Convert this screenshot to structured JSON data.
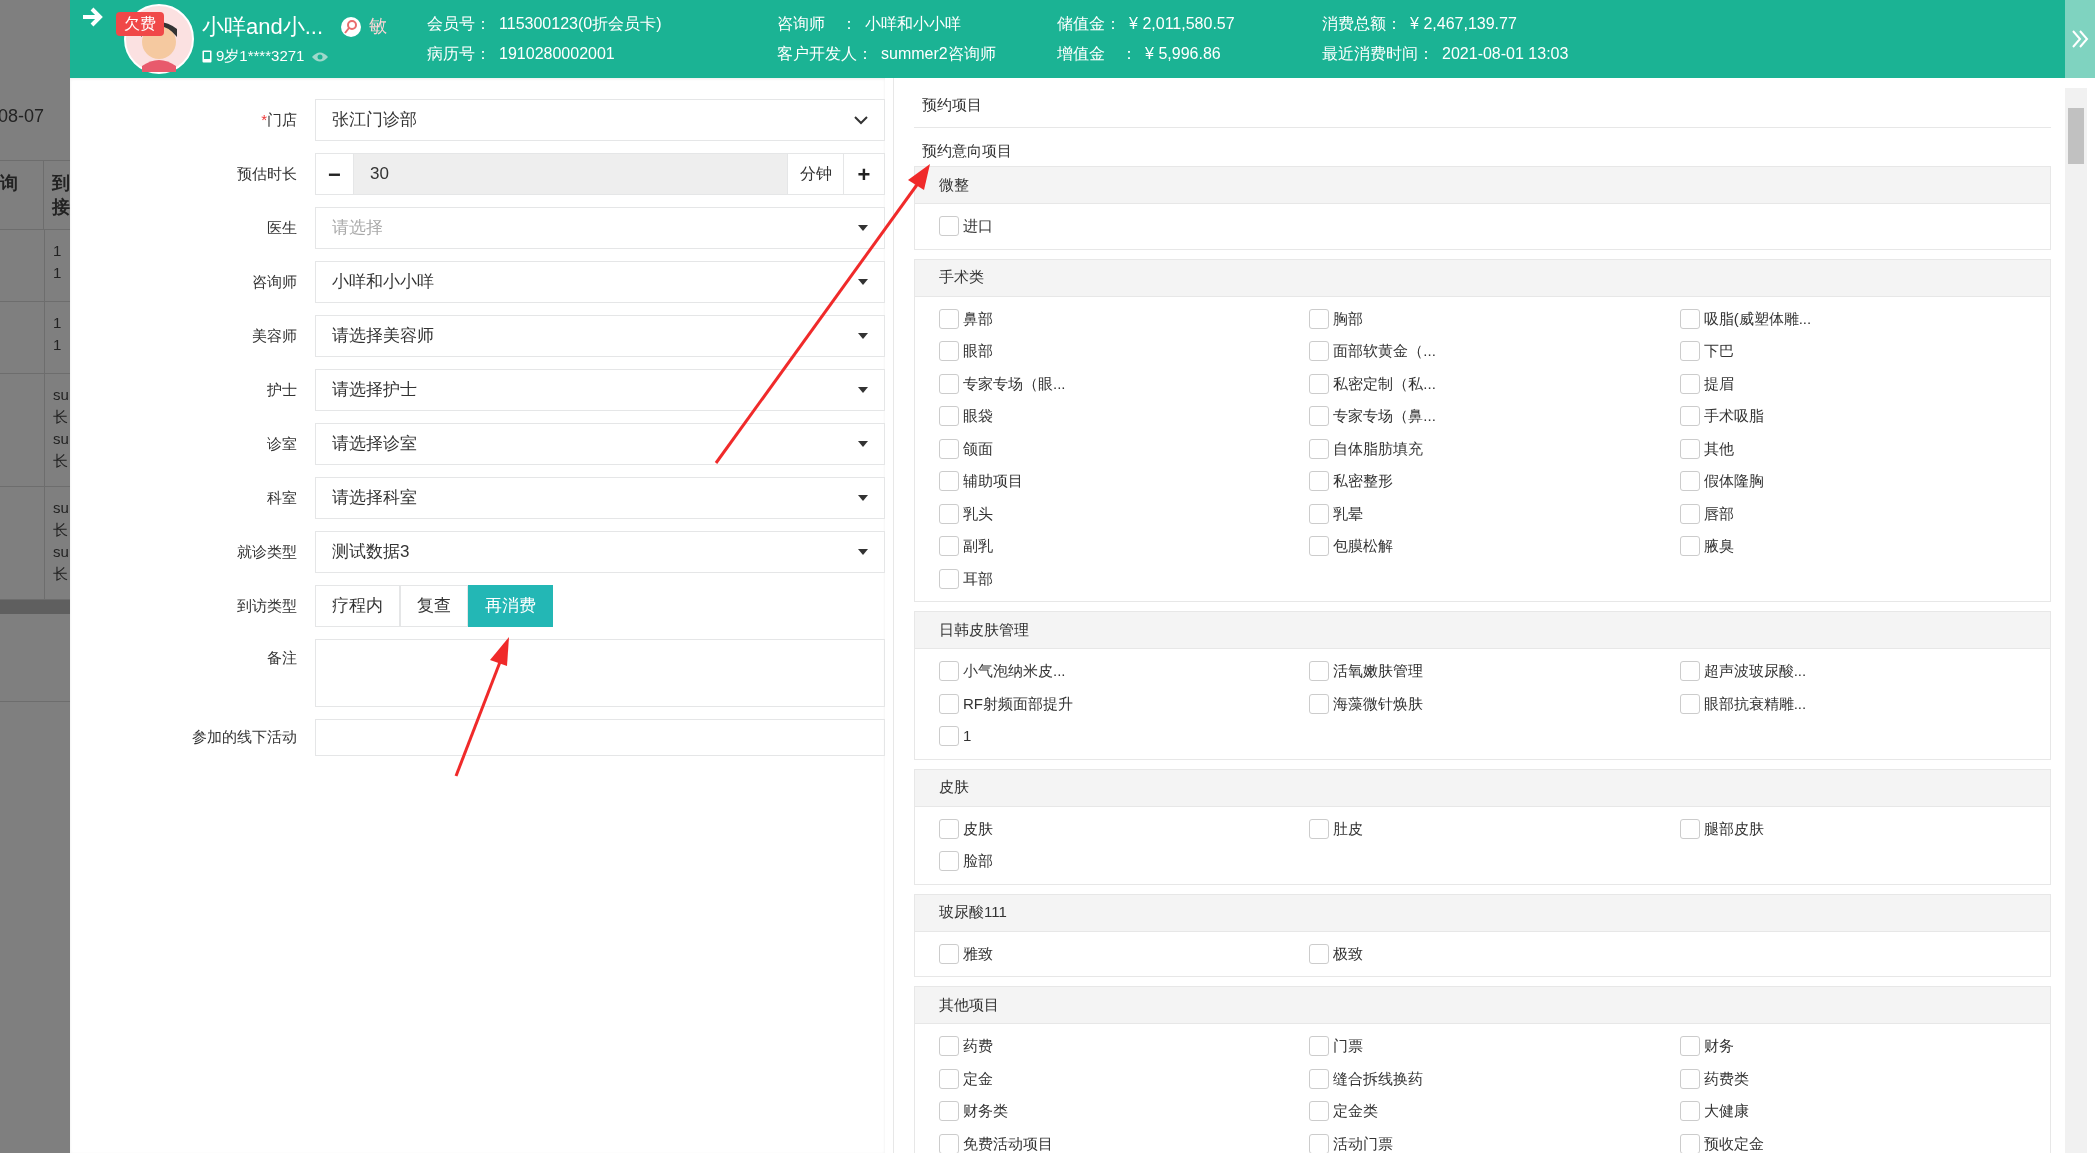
{
  "background_page": {
    "date": "08-07",
    "header_cells": [
      [
        "询"
      ],
      [
        "到",
        "接"
      ]
    ],
    "rows": [
      [
        "1",
        "1"
      ],
      [
        "1",
        "1"
      ],
      [
        "su",
        "长",
        "su",
        "长"
      ],
      [
        "su",
        "长",
        "su",
        "长"
      ]
    ]
  },
  "header": {
    "badge": "欠费",
    "name": "小咩and小...",
    "tag": "敏",
    "phone": "9岁1****3271",
    "groups": [
      [
        {
          "label": "会员号：",
          "value": "115300123(0折会员卡)"
        },
        {
          "label": "病历号：",
          "value": "1910280002001"
        }
      ],
      [
        {
          "label": "咨询师　：",
          "value": "小咩和小小咩"
        },
        {
          "label": "客户开发人：",
          "value": "summer2咨询师"
        }
      ],
      [
        {
          "label": "储值金：",
          "value": "¥ 2,011,580.57"
        },
        {
          "label": "增值金　：",
          "value": "¥ 5,996.86"
        }
      ],
      [
        {
          "label": "消费总额：",
          "value": "¥ 2,467,139.77"
        },
        {
          "label": "最近消费时间：",
          "value": "2021-08-01 13:03"
        }
      ]
    ]
  },
  "form": [
    {
      "kind": "native_select",
      "label": "门店",
      "required_mark": "*",
      "value": "张江门诊部"
    },
    {
      "kind": "stepper",
      "label": "预估时长",
      "minus": "−",
      "value": "30",
      "unit": "分钟",
      "plus": "+"
    },
    {
      "kind": "select",
      "label": "医生",
      "placeholder": "请选择"
    },
    {
      "kind": "select",
      "label": "咨询师",
      "value": "小咩和小小咩"
    },
    {
      "kind": "select",
      "label": "美容师",
      "value": "请选择美容师"
    },
    {
      "kind": "select",
      "label": "护士",
      "value": "请选择护士"
    },
    {
      "kind": "select",
      "label": "诊室",
      "value": "请选择诊室"
    },
    {
      "kind": "select",
      "label": "科室",
      "value": "请选择科室"
    },
    {
      "kind": "select",
      "label": "就诊类型",
      "value": "测试数据3"
    },
    {
      "kind": "segmented",
      "label": "到访类型",
      "options": [
        {
          "label": "疗程内",
          "selected": false
        },
        {
          "label": "复查",
          "selected": false
        },
        {
          "label": "再消费",
          "selected": true
        }
      ]
    },
    {
      "kind": "textarea",
      "label": "备注"
    },
    {
      "kind": "input",
      "label": "参加的线下活动"
    }
  ],
  "projects": {
    "title": "预约项目",
    "subtitle": "预约意向项目",
    "sections": [
      {
        "title": "微整",
        "items": [
          {
            "label": "进口",
            "checked": false
          }
        ]
      },
      {
        "title": "手术类",
        "items": [
          {
            "label": "鼻部",
            "checked": false
          },
          {
            "label": "胸部",
            "checked": false
          },
          {
            "label": "吸脂(威塑体雕...",
            "checked": false
          },
          {
            "label": "眼部",
            "checked": false
          },
          {
            "label": "面部软黄金（...",
            "checked": false
          },
          {
            "label": "下巴",
            "checked": false
          },
          {
            "label": "专家专场（眼...",
            "checked": false
          },
          {
            "label": "私密定制（私...",
            "checked": false
          },
          {
            "label": "提眉",
            "checked": false
          },
          {
            "label": "眼袋",
            "checked": false
          },
          {
            "label": "专家专场（鼻...",
            "checked": false
          },
          {
            "label": "手术吸脂",
            "checked": false
          },
          {
            "label": "颌面",
            "checked": false
          },
          {
            "label": "自体脂肪填充",
            "checked": false
          },
          {
            "label": "其他",
            "checked": false
          },
          {
            "label": "辅助项目",
            "checked": false
          },
          {
            "label": "私密整形",
            "checked": false
          },
          {
            "label": "假体隆胸",
            "checked": false
          },
          {
            "label": "乳头",
            "checked": false
          },
          {
            "label": "乳晕",
            "checked": false
          },
          {
            "label": "唇部",
            "checked": false
          },
          {
            "label": "副乳",
            "checked": false
          },
          {
            "label": "包膜松解",
            "checked": false
          },
          {
            "label": "腋臭",
            "checked": false
          },
          {
            "label": "耳部",
            "checked": false
          }
        ]
      },
      {
        "title": "日韩皮肤管理",
        "items": [
          {
            "label": "小气泡纳米皮...",
            "checked": false
          },
          {
            "label": "活氧嫩肤管理",
            "checked": false
          },
          {
            "label": "超声波玻尿酸...",
            "checked": false
          },
          {
            "label": "RF射频面部提升",
            "checked": false
          },
          {
            "label": "海藻微针焕肤",
            "checked": false
          },
          {
            "label": "眼部抗衰精雕...",
            "checked": false
          },
          {
            "label": "1",
            "checked": false
          }
        ]
      },
      {
        "title": "皮肤",
        "items": [
          {
            "label": "皮肤",
            "checked": false
          },
          {
            "label": "肚皮",
            "checked": false
          },
          {
            "label": "腿部皮肤",
            "checked": false
          },
          {
            "label": "脸部",
            "checked": false
          }
        ]
      },
      {
        "title": "玻尿酸111",
        "items": [
          {
            "label": "雅致",
            "checked": false
          },
          {
            "label": "极致",
            "checked": false
          }
        ]
      },
      {
        "title": "其他项目",
        "items": [
          {
            "label": "药费",
            "checked": false
          },
          {
            "label": "门票",
            "checked": false
          },
          {
            "label": "财务",
            "checked": false
          },
          {
            "label": "定金",
            "checked": false
          },
          {
            "label": "缝合拆线换药",
            "checked": false
          },
          {
            "label": "药费类",
            "checked": false
          },
          {
            "label": "财务类",
            "checked": false
          },
          {
            "label": "定金类",
            "checked": false
          },
          {
            "label": "大健康",
            "checked": false
          },
          {
            "label": "免费活动项目",
            "checked": false
          },
          {
            "label": "活动门票",
            "checked": false
          },
          {
            "label": "预收定金",
            "checked": false
          }
        ]
      }
    ]
  }
}
